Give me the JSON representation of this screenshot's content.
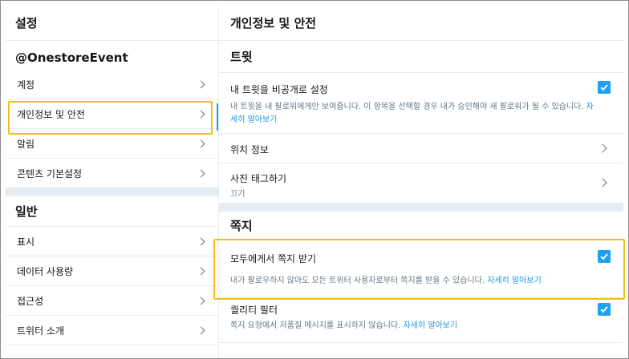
{
  "left": {
    "header": "설정",
    "account": "@OnestoreEvent",
    "account_items": [
      {
        "label": "계정"
      },
      {
        "label": "개인정보 및 안전"
      },
      {
        "label": "알림"
      },
      {
        "label": "콘텐츠 기본설정"
      }
    ],
    "general_title": "일반",
    "general_items": [
      {
        "label": "표시"
      },
      {
        "label": "데이터 사용량"
      },
      {
        "label": "접근성"
      },
      {
        "label": "트위터 소개"
      }
    ]
  },
  "right": {
    "header": "개인정보 및 안전",
    "tweets_title": "트윗",
    "protect": {
      "title": "내 트윗을 비공개로 설정",
      "desc": "내 트윗을 내 팔로워에게만 보여줍니다. 이 항목을 선택할 경우 내가 승인해야 새 팔로워가 될 수 있습니다.",
      "link": "자세히 알아보기",
      "checked": true
    },
    "location": {
      "title": "위치 정보"
    },
    "photo_tag": {
      "title": "사진 태그하기",
      "value": "끄기"
    },
    "dm_title": "쪽지",
    "dm_everyone": {
      "title": "모두에게서 쪽지 받기",
      "desc": "내가 팔로우하지 않아도 모든 트위터 사용자로부터 쪽지를 받을 수 있습니다.",
      "link": "자세히 알아보기",
      "checked": true
    },
    "quality": {
      "title": "퀄리티 필터",
      "desc": "쪽지 요청에서 저품질 메시지를 표시하지 않습니다.",
      "link": "자세히 알아보기",
      "checked": true
    }
  },
  "colors": {
    "accent": "#1da1f2",
    "highlight": "#f5bf16",
    "link": "#1b95e0"
  }
}
